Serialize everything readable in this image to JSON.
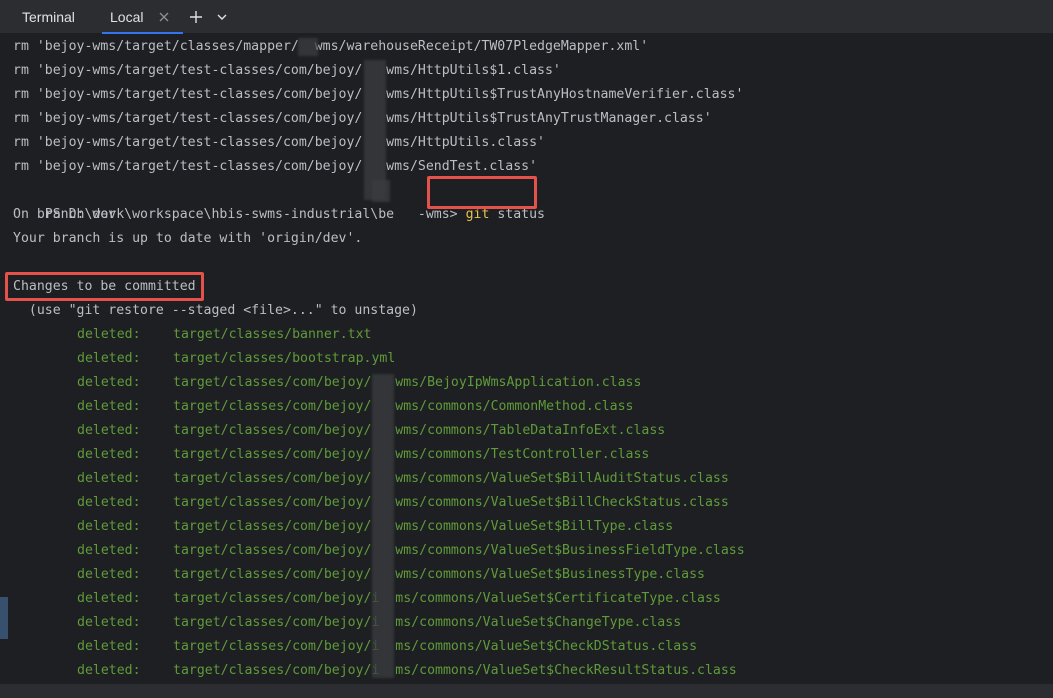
{
  "tabbar": {
    "title": "Terminal",
    "tabs": [
      {
        "label": "Local"
      }
    ]
  },
  "terminal": {
    "rm_lines": [
      "rm 'bejoy-wms/target/classes/mapper/  wms/warehouseReceipt/TW07PledgeMapper.xml'",
      "rm 'bejoy-wms/target/test-classes/com/bejoy/   wms/HttpUtils$1.class'",
      "rm 'bejoy-wms/target/test-classes/com/bejoy/   wms/HttpUtils$TrustAnyHostnameVerifier.class'",
      "rm 'bejoy-wms/target/test-classes/com/bejoy/   wms/HttpUtils$TrustAnyTrustManager.class'",
      "rm 'bejoy-wms/target/test-classes/com/bejoy/   wms/HttpUtils.class'",
      "rm 'bejoy-wms/target/test-classes/com/bejoy/   wms/SendTest.class'"
    ],
    "prompt": "PS D:\\work\\workspace\\hbis-swms-industrial\\be   -wms>",
    "command_keyword": "git",
    "command_args": "status",
    "branch_line": "On branch dev",
    "uptodate_line": "Your branch is up to date with 'origin/dev'.",
    "changes_header": "Changes to be committed",
    "hint_line": "  (use \"git restore --staged <file>...\" to unstage)",
    "deleted_label": "deleted:",
    "deleted_files": [
      "target/classes/banner.txt",
      "target/classes/bootstrap.yml",
      "target/classes/com/bejoy/   wms/BejoyIpWmsApplication.class",
      "target/classes/com/bejoy/   wms/commons/CommonMethod.class",
      "target/classes/com/bejoy/   wms/commons/TableDataInfoExt.class",
      "target/classes/com/bejoy/   wms/commons/TestController.class",
      "target/classes/com/bejoy/   wms/commons/ValueSet$BillAuditStatus.class",
      "target/classes/com/bejoy/   wms/commons/ValueSet$BillCheckStatus.class",
      "target/classes/com/bejoy/   wms/commons/ValueSet$BillType.class",
      "target/classes/com/bejoy/   wms/commons/ValueSet$BusinessFieldType.class",
      "target/classes/com/bejoy/   wms/commons/ValueSet$BusinessType.class",
      "target/classes/com/bejoy/i  ms/commons/ValueSet$CertificateType.class",
      "target/classes/com/bejoy/i  ms/commons/ValueSet$ChangeType.class",
      "target/classes/com/bejoy/i  ms/commons/ValueSet$CheckDStatus.class",
      "target/classes/com/bejoy/i  ms/commons/ValueSet$CheckResultStatus.class"
    ]
  },
  "colors": {
    "background": "#1e1f22",
    "text": "#bcbec4",
    "deleted": "#5f9b3a",
    "command": "#e6c34d",
    "highlight": "#e5514b",
    "tab_underline": "#3574f0"
  },
  "icons": [
    "close-icon",
    "plus-icon",
    "chevron-down-icon"
  ]
}
